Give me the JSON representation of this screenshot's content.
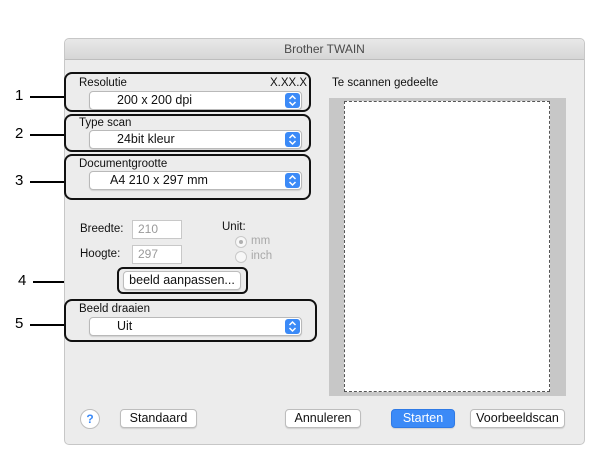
{
  "window": {
    "title": "Brother TWAIN"
  },
  "resolution": {
    "label": "Resolutie",
    "version": "X.XX.X",
    "value": "200 x 200 dpi"
  },
  "scan_type": {
    "label": "Type scan",
    "value": "24bit kleur"
  },
  "document_size": {
    "label": "Documentgrootte",
    "value": "A4  210 x 297 mm"
  },
  "dimensions": {
    "width_label": "Breedte:",
    "width_value": "210",
    "height_label": "Hoogte:",
    "height_value": "297",
    "unit_label": "Unit:",
    "unit_options": [
      "mm",
      "inch"
    ],
    "selected_unit": "mm"
  },
  "adjust_button": "beeld aanpassen...",
  "rotate": {
    "label": "Beeld draaien",
    "value": "Uit"
  },
  "preview": {
    "label": "Te scannen gedeelte"
  },
  "footer": {
    "help": "?",
    "default": "Standaard",
    "cancel": "Annuleren",
    "start": "Starten",
    "prescan": "Voorbeeldscan"
  },
  "callouts": [
    "1",
    "2",
    "3",
    "4",
    "5"
  ],
  "colors": {
    "accent": "#3b8af7",
    "callout_border": "#111111"
  }
}
